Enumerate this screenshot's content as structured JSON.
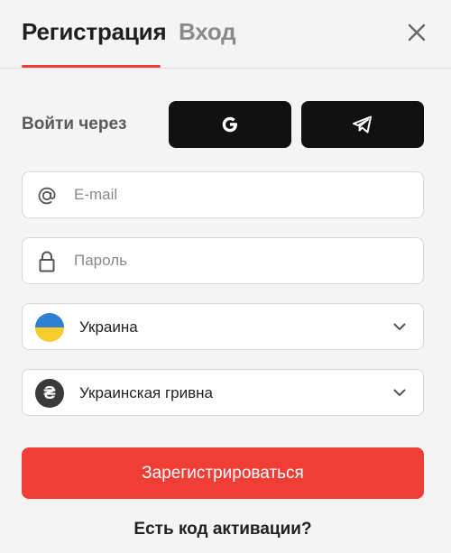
{
  "tabs": {
    "register": "Регистрация",
    "login": "Вход"
  },
  "social": {
    "label": "Войти через",
    "buttons": [
      {
        "provider": "google",
        "icon": "google-icon"
      },
      {
        "provider": "telegram",
        "icon": "telegram-icon"
      }
    ]
  },
  "form": {
    "email_placeholder": "E-mail",
    "email_value": "",
    "password_placeholder": "Пароль",
    "password_value": "",
    "country_value": "Украина",
    "currency_value": "Украинская гривна",
    "currency_symbol": "₴",
    "submit_label": "Зарегистрироваться",
    "activation_link": "Есть код активации?"
  },
  "colors": {
    "accent": "#ee3e36",
    "social_bg": "#111111",
    "flag_blue": "#2f7fd3",
    "flag_yellow": "#f7cd30"
  }
}
